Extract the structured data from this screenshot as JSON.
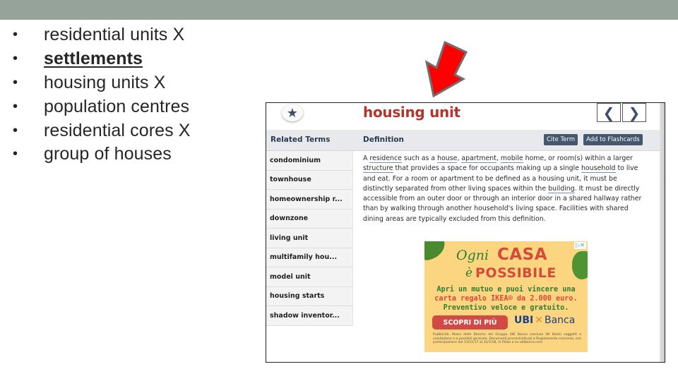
{
  "slide": {
    "bullets": [
      {
        "text": "residential units X",
        "emphasis": false
      },
      {
        "text": "settlements",
        "emphasis": true
      },
      {
        "text": "housing units X",
        "emphasis": false
      },
      {
        "text": "population centres",
        "emphasis": false
      },
      {
        "text": "residential cores X",
        "emphasis": false
      },
      {
        "text": "group of houses",
        "emphasis": false
      }
    ],
    "bullet_glyph": "•",
    "arrow_color": "#ff0000"
  },
  "dictionary": {
    "favorite_icon": "★",
    "term": "housing unit",
    "nav": {
      "prev": "❮",
      "next": "❯"
    },
    "related_terms_header": "Related Terms",
    "definition_header": "Definition",
    "buttons": {
      "cite": "Cite Term",
      "flashcards": "Add to Flashcards"
    },
    "related_terms": [
      "condominium",
      "townhouse",
      "homeownership r...",
      "downzone",
      "living unit",
      "multifamily hou...",
      "model unit",
      "housing starts",
      "shadow inventor..."
    ],
    "definition": {
      "t0": "A ",
      "l1": "residence",
      "t1": " such as a ",
      "l2": "house",
      "t2": ", ",
      "l3": "apartment",
      "t3": ", ",
      "l4": "mobile",
      "t4": " home, or room(s) within a larger ",
      "l5": "structure",
      "t5": " that provides a space for occupants making up a single ",
      "l6": "household",
      "t6": " to live and eat. For a room or apartment to be defined as a housing unit, it must be distinctly separated from other living spaces within the ",
      "l7": "building",
      "t7": ". It must be directly accessible from an outer door or through an interior door in a shared hallway rather than by walking through another household's living space. Facilities with shared dining areas are typically excluded from this definition."
    },
    "ad": {
      "badge": "▷✕",
      "headline_1a": "Ogni",
      "headline_1b": "CASA",
      "headline_2a": "è",
      "headline_2b": "POSSIBILE",
      "line1": "Apri un mutuo e puoi vincere una",
      "line2": "carta regalo IKEA® da 2.000 euro.",
      "line3": "Preventivo veloce e gratuito.",
      "cta": "SCOPRI DI PIÙ",
      "logo_left": "UBI",
      "logo_mark": "✕",
      "logo_right": "Banca",
      "fine_print": "Pubblicità. Mutui delle Banche del Gruppo UBI Banca (esclusa IW Bank) soggetti a valutazione e a possibili garanzie. Documenti precontrattuali e Regolamento concorso, con partecipazione dal 13/11/17 al 31/1/18, in filiale e su ubibanca.com."
    }
  }
}
